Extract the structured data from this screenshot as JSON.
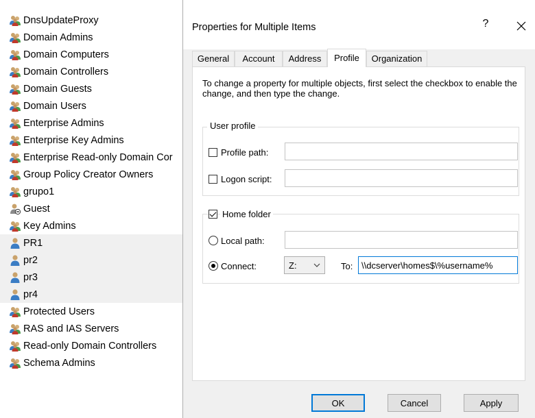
{
  "object_list": {
    "items": [
      {
        "label": "DnsUpdateProxy",
        "icon": "group-icon",
        "selected": false
      },
      {
        "label": "Domain Admins",
        "icon": "group-icon",
        "selected": false
      },
      {
        "label": "Domain Computers",
        "icon": "group-icon",
        "selected": false
      },
      {
        "label": "Domain Controllers",
        "icon": "group-icon",
        "selected": false
      },
      {
        "label": "Domain Guests",
        "icon": "group-icon",
        "selected": false
      },
      {
        "label": "Domain Users",
        "icon": "group-icon",
        "selected": false
      },
      {
        "label": "Enterprise Admins",
        "icon": "group-icon",
        "selected": false
      },
      {
        "label": "Enterprise Key Admins",
        "icon": "group-icon",
        "selected": false
      },
      {
        "label": "Enterprise Read-only Domain Cor",
        "icon": "group-icon",
        "selected": false
      },
      {
        "label": "Group Policy Creator Owners",
        "icon": "group-icon",
        "selected": false
      },
      {
        "label": "grupo1",
        "icon": "group-icon",
        "selected": false
      },
      {
        "label": "Guest",
        "icon": "disabled-user-icon",
        "selected": false
      },
      {
        "label": "Key Admins",
        "icon": "group-icon",
        "selected": false
      },
      {
        "label": "PR1",
        "icon": "user-icon",
        "selected": true
      },
      {
        "label": "pr2",
        "icon": "user-icon",
        "selected": true
      },
      {
        "label": "pr3",
        "icon": "user-icon",
        "selected": true
      },
      {
        "label": "pr4",
        "icon": "user-icon",
        "selected": true
      },
      {
        "label": "Protected Users",
        "icon": "group-icon",
        "selected": false
      },
      {
        "label": "RAS and IAS Servers",
        "icon": "group-icon",
        "selected": false
      },
      {
        "label": "Read-only Domain Controllers",
        "icon": "group-icon",
        "selected": false
      },
      {
        "label": "Schema Admins",
        "icon": "group-icon",
        "selected": false
      }
    ]
  },
  "dialog": {
    "title": "Properties for Multiple Items",
    "help_label": "?",
    "close_label": "✕",
    "tabs": [
      {
        "label": "General",
        "active": false
      },
      {
        "label": "Account",
        "active": false
      },
      {
        "label": "Address",
        "active": false
      },
      {
        "label": "Profile",
        "active": true
      },
      {
        "label": "Organization",
        "active": false
      }
    ],
    "instructions": "To change a property for multiple objects, first select the checkbox to enable the change, and then type the change.",
    "user_profile": {
      "legend": "User profile",
      "profile_path": {
        "label": "Profile path:",
        "checked": false,
        "value": ""
      },
      "logon_script": {
        "label": "Logon script:",
        "checked": false,
        "value": ""
      }
    },
    "home_folder": {
      "legend": "Home folder",
      "checked": true,
      "local_path": {
        "label": "Local path:",
        "selected": false,
        "value": ""
      },
      "connect": {
        "label": "Connect:",
        "selected": true,
        "drive": "Z:",
        "to_label": "To:",
        "value": "\\\\dcserver\\homes$\\%username%"
      }
    },
    "buttons": {
      "ok": "OK",
      "cancel": "Cancel",
      "apply": "Apply"
    }
  },
  "colors": {
    "accent": "#0078d7",
    "selection": "#f0f0f0",
    "dialog_bg": "#f0f0f0"
  }
}
